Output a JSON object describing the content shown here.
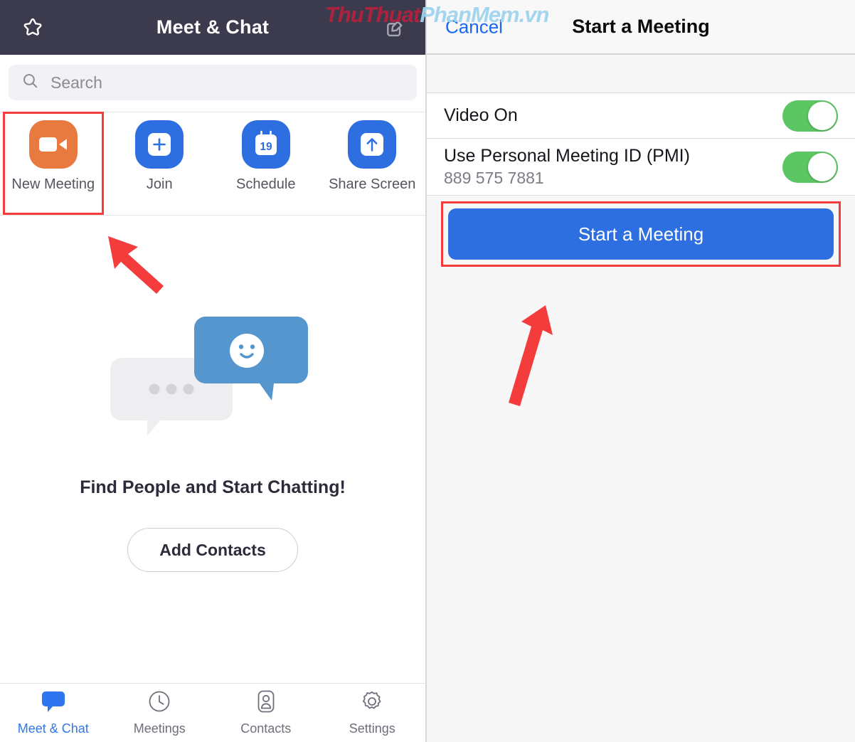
{
  "watermark": {
    "part1": "ThuThuat",
    "part2": "PhanMem",
    "part3": ".vn"
  },
  "left_panel": {
    "header": {
      "title": "Meet & Chat",
      "star_icon": "star-icon",
      "compose_icon": "compose-new-chat-icon"
    },
    "search": {
      "placeholder": "Search",
      "icon": "search-icon"
    },
    "actions": [
      {
        "label": "New Meeting",
        "icon": "video-camera-icon",
        "color": "#e8793f",
        "highlighted": true
      },
      {
        "label": "Join",
        "icon": "plus-icon",
        "color": "#2d6fe0",
        "highlighted": false
      },
      {
        "label": "Schedule",
        "icon": "calendar-icon",
        "color": "#2d6fe0",
        "highlighted": false,
        "calendar_day": "19"
      },
      {
        "label": "Share Screen",
        "icon": "arrow-up-icon",
        "color": "#2d6fe0",
        "highlighted": false
      }
    ],
    "empty_state": {
      "illustration": "two-chat-bubbles-illustration",
      "title": "Find People and Start Chatting!",
      "button_label": "Add Contacts"
    },
    "tabs": [
      {
        "label": "Meet & Chat",
        "icon": "chat-bubble-icon",
        "active": true
      },
      {
        "label": "Meetings",
        "icon": "clock-icon",
        "active": false
      },
      {
        "label": "Contacts",
        "icon": "contact-card-icon",
        "active": false
      },
      {
        "label": "Settings",
        "icon": "gear-icon",
        "active": false
      }
    ]
  },
  "right_panel": {
    "header": {
      "cancel_label": "Cancel",
      "title": "Start a Meeting"
    },
    "settings": [
      {
        "title": "Video On",
        "subtitle": "",
        "toggle_on": true
      },
      {
        "title": "Use Personal Meeting ID (PMI)",
        "subtitle": "889 575 7881",
        "toggle_on": true
      }
    ],
    "start_button": {
      "label": "Start a Meeting",
      "highlighted": true
    }
  },
  "annotations": {
    "arrow_left": "red-arrow-pointing-to-new-meeting",
    "arrow_right": "red-arrow-pointing-to-start-a-meeting",
    "highlight_color": "#f43c3c"
  }
}
